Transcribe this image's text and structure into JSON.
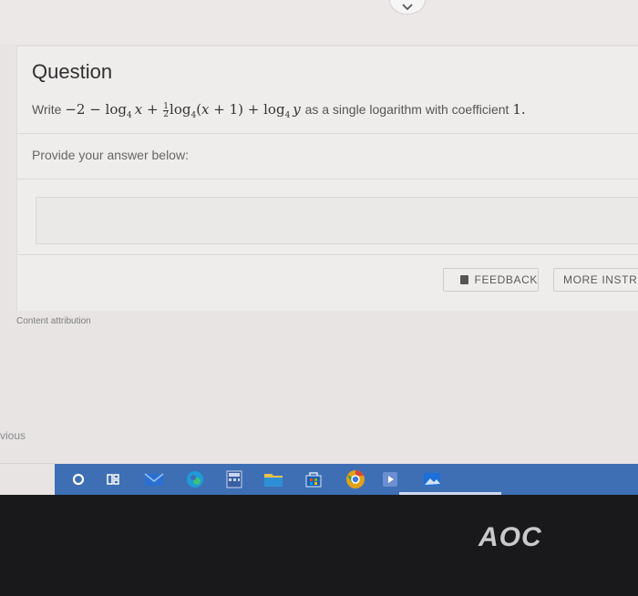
{
  "question": {
    "title": "Question",
    "prompt_prefix": "Write",
    "prompt_suffix": "as a single logarithm with coefficient",
    "prompt_number": "1",
    "provide_label": "Provide your answer below:",
    "answer_value": ""
  },
  "buttons": {
    "feedback": "FEEDBACK",
    "more": "MORE INSTRU"
  },
  "footer": {
    "attribution": "Content attribution",
    "previous": "vious"
  },
  "monitor": {
    "brand": "AOC"
  },
  "taskbar_icons": [
    "search-icon",
    "task-view-icon",
    "mail-icon",
    "edge-icon",
    "calculator-icon",
    "file-explorer-icon",
    "store-icon",
    "chrome-icon",
    "media-player-icon",
    "photos-icon"
  ],
  "colors": {
    "taskbar": "#3e6fb5",
    "background": "#e7e4e3",
    "bezel": "#19191b"
  }
}
